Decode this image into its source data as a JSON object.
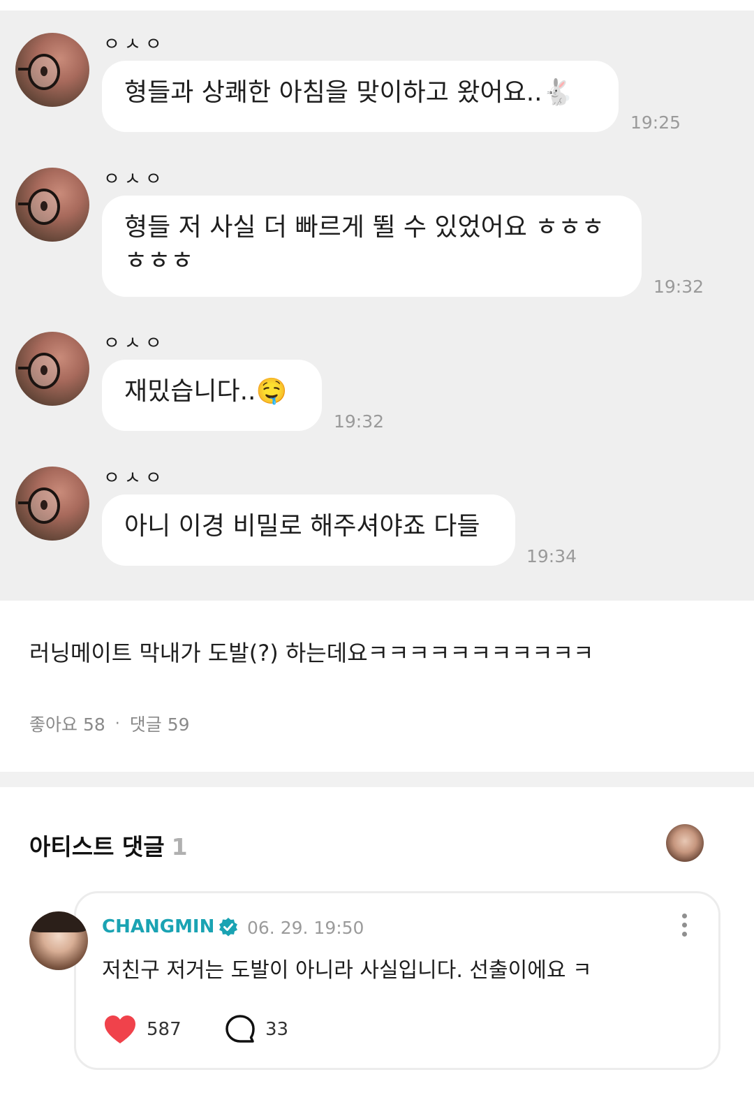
{
  "messages": [
    {
      "sender": "ㅇㅅㅇ",
      "text": "형들과 상쾌한 아침을 맞이하고 왔어요..",
      "emoji": "🐇",
      "time": "19:25"
    },
    {
      "sender": "ㅇㅅㅇ",
      "text_line1": "형들 저 사실 더 빠르게 뛸 수 있었어요 ㅎㅎㅎ",
      "text_line2": "ㅎㅎㅎ",
      "time": "19:32"
    },
    {
      "sender": "ㅇㅅㅇ",
      "text": "재밌습니다..",
      "emoji": "🤤",
      "time": "19:32"
    },
    {
      "sender": "ㅇㅅㅇ",
      "text": "아니 이경 비밀로 해주셔야죠 다들",
      "time": "19:34"
    }
  ],
  "post": {
    "text": "러닝메이트 막내가 도발(?) 하는데요ㅋㅋㅋㅋㅋㅋㅋㅋㅋㅋㅋ",
    "likes_label": "좋아요 58",
    "separator": "·",
    "comments_label": "댓글 59"
  },
  "artist_comments": {
    "title": "아티스트 댓글",
    "count": "1",
    "comment": {
      "author": "CHANGMIN",
      "date": "06. 29. 19:50",
      "text": "저친구 저거는 도발이 아니라 사실입니다. 선출이에요 ㅋ",
      "likes": "587",
      "replies": "33"
    }
  },
  "colors": {
    "chat_background": "#efefef",
    "bubble": "#ffffff",
    "author_name": "#1aa3b3",
    "heart": "#f0424b"
  },
  "icons": {
    "verified": "verified-badge-icon",
    "more": "more-vertical-icon",
    "like": "heart-icon",
    "reply": "speech-bubble-icon"
  }
}
